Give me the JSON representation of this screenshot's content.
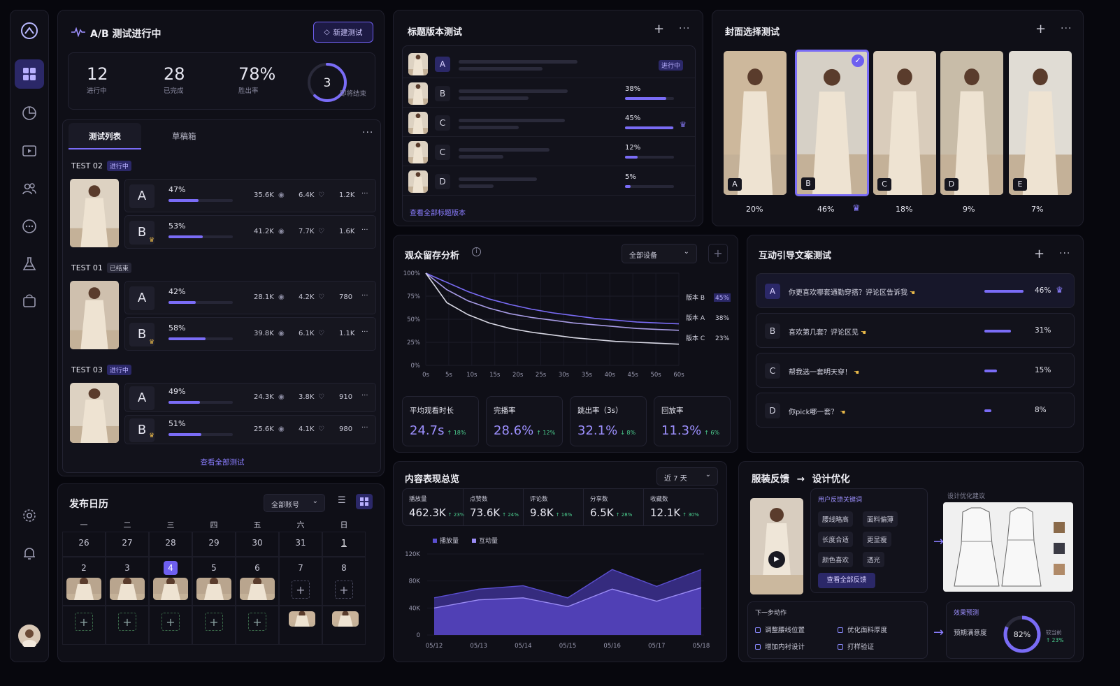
{
  "colors": {
    "accent": "#7a6cf6",
    "bg": "#07070d",
    "panel": "#0f0f17",
    "success": "#4dd392",
    "gold": "#e9b949"
  },
  "sidebar": {
    "icons": [
      "logo-icon",
      "dashboard-icon",
      "analytics-icon",
      "video-icon",
      "users-icon",
      "message-icon",
      "lab-icon",
      "shop-icon",
      "settings-icon",
      "bell-icon",
      "avatar"
    ]
  },
  "ab": {
    "title": "A/B 测试进行中",
    "new_button": "新建测试",
    "stats": [
      {
        "value": "12",
        "label": "进行中"
      },
      {
        "value": "28",
        "label": "已完成"
      },
      {
        "value": "78%",
        "label": "胜出率"
      }
    ],
    "ring": {
      "value": "3",
      "label": "即将结束",
      "progress": 0.62
    },
    "tabs": [
      "测试列表",
      "草稿箱"
    ],
    "tests": [
      {
        "name": "TEST 02",
        "status": "进行中",
        "variants": [
          {
            "letter": "A",
            "pct": "47%",
            "ratio": 0.47,
            "views": "35.6K",
            "likes": "6.4K",
            "comments": "1.2K",
            "winner": false
          },
          {
            "letter": "B",
            "pct": "53%",
            "ratio": 0.53,
            "views": "41.2K",
            "likes": "7.7K",
            "comments": "1.6K",
            "winner": true
          }
        ]
      },
      {
        "name": "TEST 01",
        "status": "已结束",
        "variants": [
          {
            "letter": "A",
            "pct": "42%",
            "ratio": 0.42,
            "views": "28.1K",
            "likes": "4.2K",
            "comments": "780",
            "winner": false
          },
          {
            "letter": "B",
            "pct": "58%",
            "ratio": 0.58,
            "views": "39.8K",
            "likes": "6.1K",
            "comments": "1.1K",
            "winner": true
          }
        ]
      },
      {
        "name": "TEST 03",
        "status": "进行中",
        "variants": [
          {
            "letter": "A",
            "pct": "49%",
            "ratio": 0.49,
            "views": "24.3K",
            "likes": "3.8K",
            "comments": "910",
            "winner": false
          },
          {
            "letter": "B",
            "pct": "51%",
            "ratio": 0.51,
            "views": "25.6K",
            "likes": "4.1K",
            "comments": "980",
            "winner": true
          }
        ]
      }
    ],
    "view_all": "查看全部测试"
  },
  "calendar": {
    "title": "发布日历",
    "account": "全部账号",
    "weekdays": [
      "一",
      "二",
      "三",
      "四",
      "五",
      "六",
      "日"
    ],
    "row1": [
      "26",
      "27",
      "28",
      "29",
      "30",
      "31",
      "1"
    ],
    "row2": [
      "2",
      "3",
      "4",
      "5",
      "6",
      "7",
      "8"
    ],
    "today": "4"
  },
  "headline": {
    "title": "标题版本测试",
    "rows": [
      {
        "letter": "A",
        "status": "进行中",
        "pct": "",
        "ratio": 0
      },
      {
        "letter": "B",
        "pct": "38%",
        "ratio": 0.38
      },
      {
        "letter": "C",
        "pct": "45%",
        "ratio": 0.45,
        "winner": true
      },
      {
        "letter": "C",
        "pct": "12%",
        "ratio": 0.12
      },
      {
        "letter": "D",
        "pct": "5%",
        "ratio": 0.05
      }
    ],
    "view_all": "查看全部标题版本"
  },
  "cover": {
    "title": "封面选择测试",
    "items": [
      {
        "letter": "A",
        "pct": "20%"
      },
      {
        "letter": "B",
        "pct": "46%",
        "selected": true
      },
      {
        "letter": "C",
        "pct": "18%"
      },
      {
        "letter": "D",
        "pct": "9%"
      },
      {
        "letter": "E",
        "pct": "7%"
      }
    ]
  },
  "retention": {
    "title": "观众留存分析",
    "device": "全部设备",
    "kpis": [
      {
        "label": "平均观看时长",
        "value": "24.7s",
        "delta": "↑ 18%"
      },
      {
        "label": "完播率",
        "value": "28.6%",
        "delta": "↑ 12%"
      },
      {
        "label": "跳出率（3s）",
        "value": "32.1%",
        "delta": "↓ 8%"
      },
      {
        "label": "回放率",
        "value": "11.3%",
        "delta": "↑ 6%"
      }
    ]
  },
  "engage": {
    "title": "互动引导文案测试",
    "rows": [
      {
        "letter": "A",
        "text": "你更喜欢哪套通勤穿搭？评论区告诉我",
        "pct": "46%",
        "ratio": 0.46,
        "winner": true
      },
      {
        "letter": "B",
        "text": "喜欢第几套？评论区见",
        "pct": "31%",
        "ratio": 0.31
      },
      {
        "letter": "C",
        "text": "帮我选一套明天穿！",
        "pct": "15%",
        "ratio": 0.15
      },
      {
        "letter": "D",
        "text": "你pick哪一套？",
        "pct": "8%",
        "ratio": 0.08
      }
    ]
  },
  "overview": {
    "title": "内容表现总览",
    "range": "近 7 天",
    "metrics": [
      {
        "label": "播放量",
        "value": "462.3K",
        "delta": "↑ 23%"
      },
      {
        "label": "点赞数",
        "value": "73.6K",
        "delta": "↑ 24%"
      },
      {
        "label": "评论数",
        "value": "9.8K",
        "delta": "↑ 16%"
      },
      {
        "label": "分享数",
        "value": "6.5K",
        "delta": "↑ 28%"
      },
      {
        "label": "收藏数",
        "value": "12.1K",
        "delta": "↑ 30%"
      }
    ]
  },
  "feedback": {
    "title_left": "服装反馈",
    "title_right": "设计优化",
    "keywords_title": "用户反馈关键词",
    "keywords": [
      "腰线略高",
      "面料偏薄",
      "长度合适",
      "更显瘦",
      "颜色喜欢",
      "透光"
    ],
    "view_all": "查看全部反馈",
    "design_title": "设计优化建议",
    "next_title": "下一步动作",
    "actions": [
      "调整腰线位置",
      "优化面料厚度",
      "增加内衬设计",
      "打样验证"
    ],
    "forecast_title": "效果预测",
    "forecast_label": "预期满意度",
    "forecast_value": "82%",
    "forecast_progress": 0.82,
    "forecast_note_1": "较当前",
    "forecast_note_2": "↑ 23%"
  },
  "chart_data": [
    {
      "type": "line",
      "x": [
        0,
        5,
        10,
        15,
        20,
        25,
        30,
        35,
        40,
        45,
        50,
        55,
        60
      ],
      "xticks": [
        "0s",
        "5s",
        "10s",
        "15s",
        "20s",
        "25s",
        "30s",
        "35s",
        "40s",
        "45s",
        "50s",
        "60s"
      ],
      "yticks": [
        "100%",
        "75%",
        "50%",
        "25%",
        "0%"
      ],
      "ylim": [
        0,
        100
      ],
      "series": [
        {
          "name": "版本 B",
          "label": "45%",
          "color": "#7a6cf6",
          "values": [
            100,
            90,
            80,
            72,
            66,
            61,
            57,
            54,
            51,
            49,
            47,
            46,
            45
          ]
        },
        {
          "name": "版本 A",
          "label": "38%",
          "color": "#a89ce6",
          "values": [
            100,
            82,
            70,
            62,
            56,
            52,
            49,
            46,
            44,
            42,
            40,
            39,
            38
          ]
        },
        {
          "name": "版本 C",
          "label": "23%",
          "color": "#d8d8e4",
          "values": [
            100,
            68,
            55,
            46,
            40,
            36,
            33,
            30,
            28,
            26,
            25,
            24,
            23
          ]
        }
      ]
    },
    {
      "type": "area",
      "categories": [
        "05/12",
        "05/13",
        "05/14",
        "05/15",
        "05/16",
        "05/17",
        "05/18"
      ],
      "yticks": [
        "120K",
        "80K",
        "40K",
        "0"
      ],
      "ylim": [
        0,
        120000
      ],
      "series": [
        {
          "name": "播放量",
          "color": "#5b4fd0",
          "values": [
            55000,
            68000,
            73000,
            55000,
            97000,
            72000,
            97000
          ]
        },
        {
          "name": "互动量",
          "color": "#9b8cf5",
          "values": [
            40000,
            52000,
            55000,
            42000,
            68000,
            50000,
            70000
          ]
        }
      ]
    }
  ]
}
